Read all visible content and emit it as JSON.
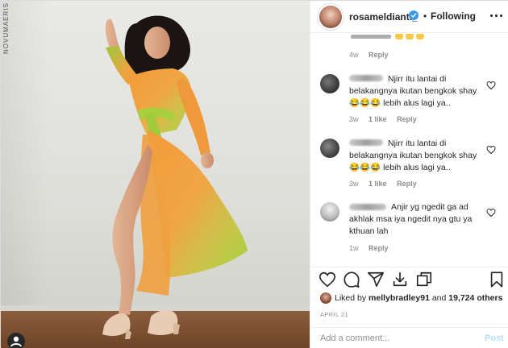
{
  "photo": {
    "watermark": "NOVUMAERIS",
    "alt_icon": "person-icon"
  },
  "header": {
    "username": "rosameldianti_",
    "separator": "•",
    "follow_label": "Following",
    "verified_icon": "verified-badge-icon",
    "more_icon": "more-options-icon"
  },
  "comments": {
    "cut_text": "",
    "first_meta": {
      "time": "4w",
      "reply": "Reply"
    },
    "items": [
      {
        "text": "Njirr itu lantai di\nbelakangnya ikutan bengkok shay\n😂😂😂 lebih alus lagi ya..",
        "time": "3w",
        "likes": "1 like",
        "reply": "Reply"
      },
      {
        "text": "Njirr itu lantai di\nbelakangnya ikutan bengkok shay\n😂😂😂 lebih alus lagi ya..",
        "time": "3w",
        "likes": "1 like",
        "reply": "Reply"
      },
      {
        "text": "Anjir yg ngedit ga ad\nakhlak msa iya ngedit nya gtu ya\nkthuan lah",
        "time": "1w",
        "likes": "",
        "reply": "Reply"
      }
    ]
  },
  "actions": {
    "icons": [
      "heart-icon",
      "comment-icon",
      "share-icon",
      "download-icon",
      "copy-icon",
      "bookmark-icon"
    ]
  },
  "liked_by": {
    "prefix": "Liked by ",
    "user": "mellybradley91",
    "middle": " and ",
    "count": "19,724 others"
  },
  "date": "APRIL 21",
  "add_comment": {
    "placeholder": "Add a comment...",
    "post_label": "Post"
  },
  "colors": {
    "dress_orange": "#f29a3c",
    "dress_green": "#a8d043",
    "link_blue": "#3897f0",
    "post_disabled": "#b2dffc"
  }
}
